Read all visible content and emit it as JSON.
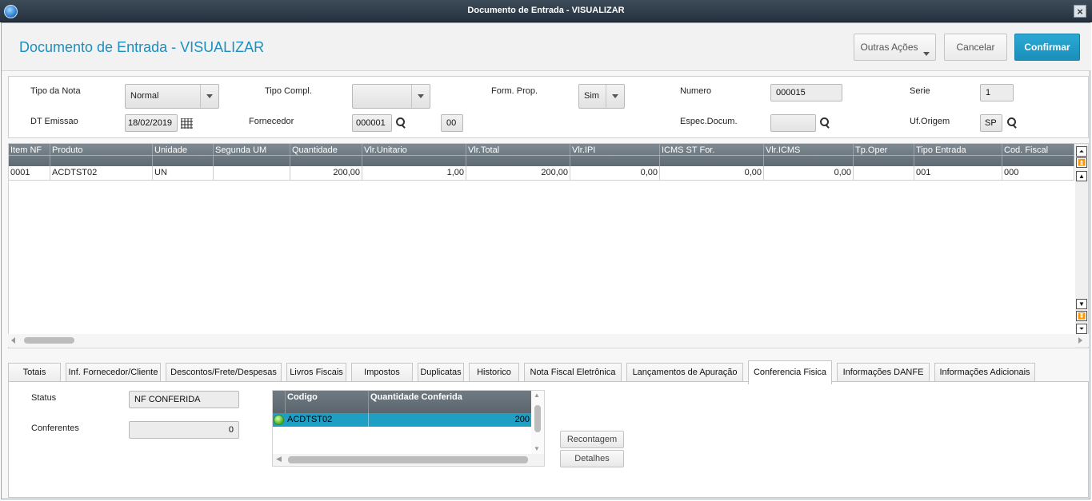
{
  "window": {
    "title": "Documento de Entrada - VISUALIZAR"
  },
  "header": {
    "page_title": "Documento de Entrada - VISUALIZAR",
    "outras_acoes": "Outras Ações",
    "cancelar": "Cancelar",
    "confirmar": "Confirmar"
  },
  "form": {
    "tipo_nota_label": "Tipo da Nota",
    "tipo_nota_value": "Normal",
    "tipo_compl_label": "Tipo Compl.",
    "tipo_compl_value": "",
    "form_prop_label": "Form. Prop.",
    "form_prop_value": "Sim",
    "numero_label": "Numero",
    "numero_value": "000015",
    "serie_label": "Serie",
    "serie_value": "1",
    "dt_emissao_label": "DT Emissao",
    "dt_emissao_value": "18/02/2019",
    "fornecedor_label": "Fornecedor",
    "fornecedor_value": "000001",
    "fornecedor_loja": "00",
    "espec_label": "Espec.Docum.",
    "espec_value": "",
    "uf_label": "Uf.Origem",
    "uf_value": "SP"
  },
  "items_grid": {
    "columns": [
      "Item NF",
      "Produto",
      "Unidade",
      "Segunda UM",
      "Quantidade",
      "Vlr.Unitario",
      "Vlr.Total",
      "Vlr.IPI",
      "ICMS ST For.",
      "Vlr.ICMS",
      "Tp.Oper",
      "Tipo Entrada",
      "Cod. Fiscal"
    ],
    "rows": [
      [
        "0001",
        "ACDTST02",
        "UN",
        "",
        "200,00",
        "1,00",
        "200,00",
        "0,00",
        "0,00",
        "0,00",
        "",
        "001",
        "000"
      ]
    ]
  },
  "tabs": [
    "Totais",
    "Inf. Fornecedor/Cliente",
    "Descontos/Frete/Despesas",
    "Livros Fiscais",
    "Impostos",
    "Duplicatas",
    "Historico",
    "Nota Fiscal Eletrônica",
    "Lançamentos de Apuração",
    "Conferencia Fisica",
    "Informações DANFE",
    "Informações Adicionais"
  ],
  "active_tab": "Conferencia Fisica",
  "conferencia": {
    "status_label": "Status",
    "status_value": "NF CONFERIDA",
    "conferentes_label": "Conferentes",
    "conferentes_value": "0",
    "grid_columns": [
      "Codigo",
      "Quantidade Conferida"
    ],
    "grid_rows": [
      [
        "ACDTST02",
        "200"
      ]
    ],
    "recontagem": "Recontagem",
    "detalhes": "Detalhes",
    "row_status_color": "#55b526",
    "selected_row_color": "#1f9fc4"
  },
  "colors": {
    "accent": "#1c8fbd",
    "confirm_button": "#1a8fba",
    "grid_header": "#6b767e"
  }
}
